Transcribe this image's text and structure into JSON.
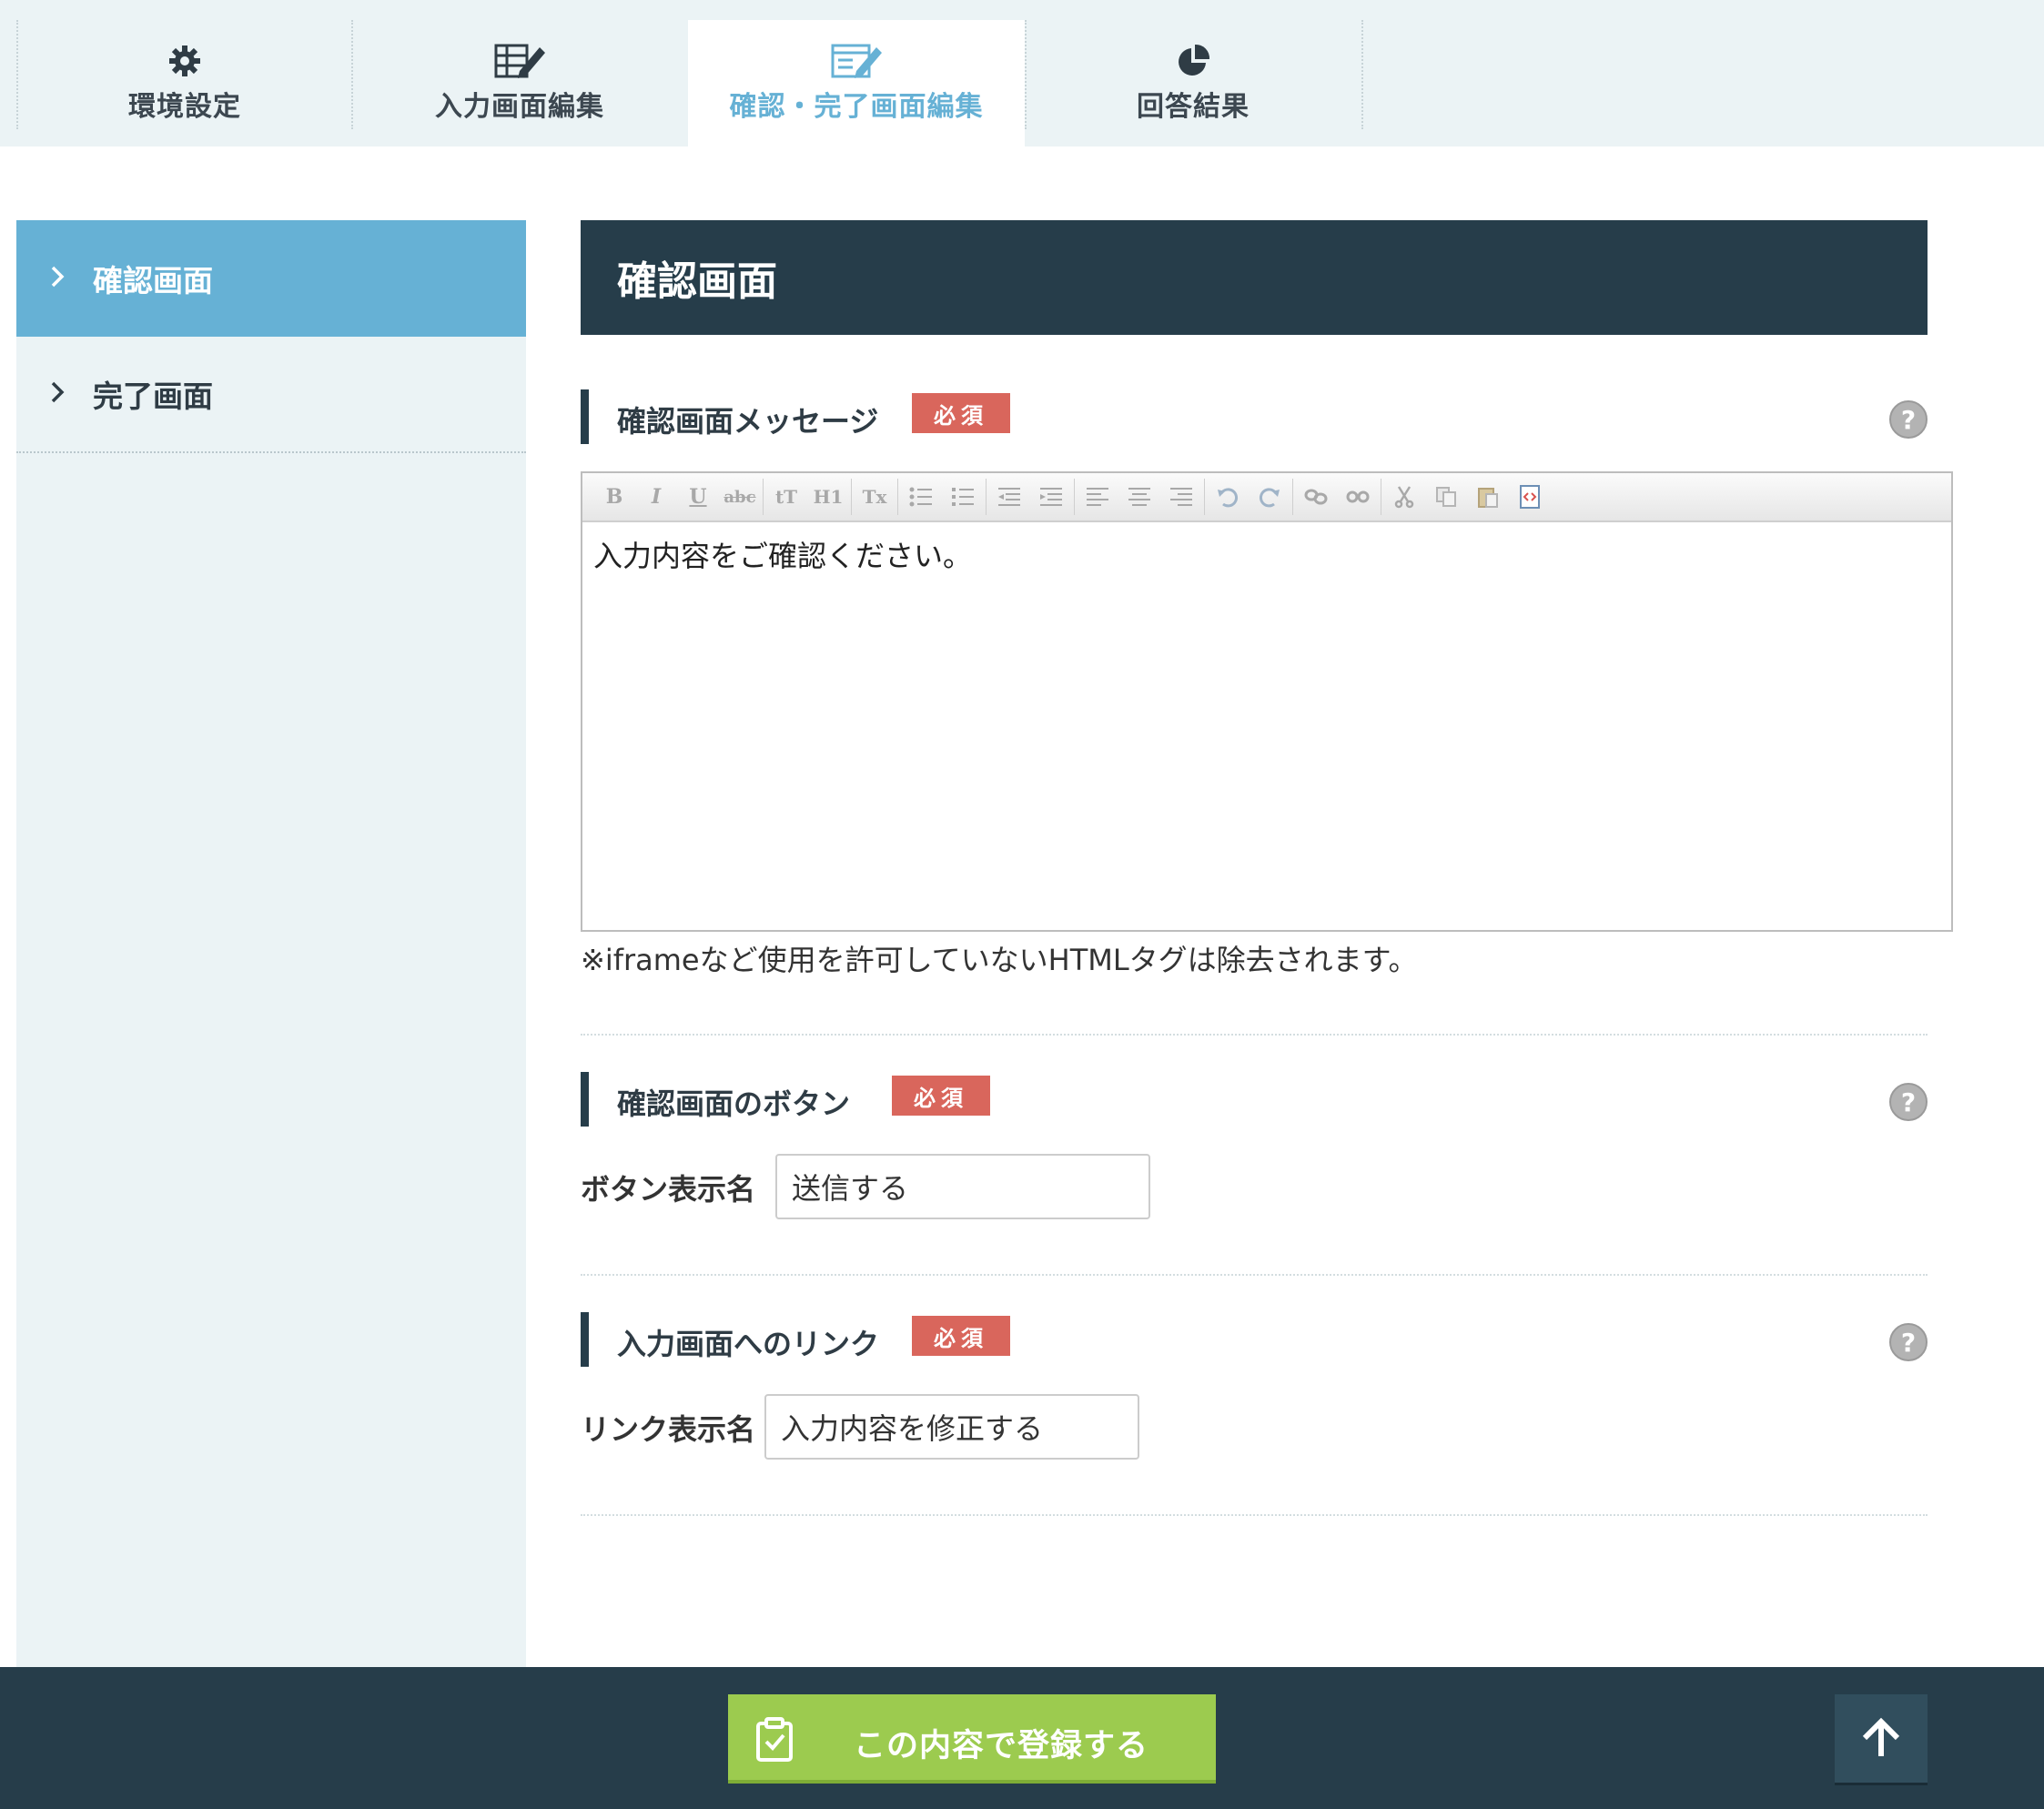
{
  "tabs": [
    {
      "label": "環境設定",
      "icon": "gear-icon"
    },
    {
      "label": "入力画面編集",
      "icon": "table-edit-icon"
    },
    {
      "label": "確認・完了画面編集",
      "icon": "form-edit-icon"
    },
    {
      "label": "回答結果",
      "icon": "pie-chart-icon"
    }
  ],
  "sidebar": {
    "items": [
      {
        "label": "確認画面"
      },
      {
        "label": "完了画面"
      }
    ]
  },
  "page_title": "確認画面",
  "required_label": "必須",
  "sections": {
    "message": {
      "title": "確認画面メッセージ",
      "editor_text": "入力内容をご確認ください。",
      "note": "※iframeなど使用を許可していないHTMLタグは除去されます。"
    },
    "button": {
      "title": "確認画面のボタン",
      "field_label": "ボタン表示名",
      "field_value": "送信する"
    },
    "link": {
      "title": "入力画面へのリンク",
      "field_label": "リンク表示名",
      "field_value": "入力内容を修正する"
    }
  },
  "toolbar_buttons": [
    "B",
    "I",
    "U",
    "abc",
    "tT",
    "H1",
    "Tx"
  ],
  "footer": {
    "submit_label": "この内容で登録する"
  },
  "colors": {
    "accent": "#66b1d5",
    "dark": "#263d4a",
    "required": "#d9665c",
    "submit": "#9ccb4f"
  }
}
